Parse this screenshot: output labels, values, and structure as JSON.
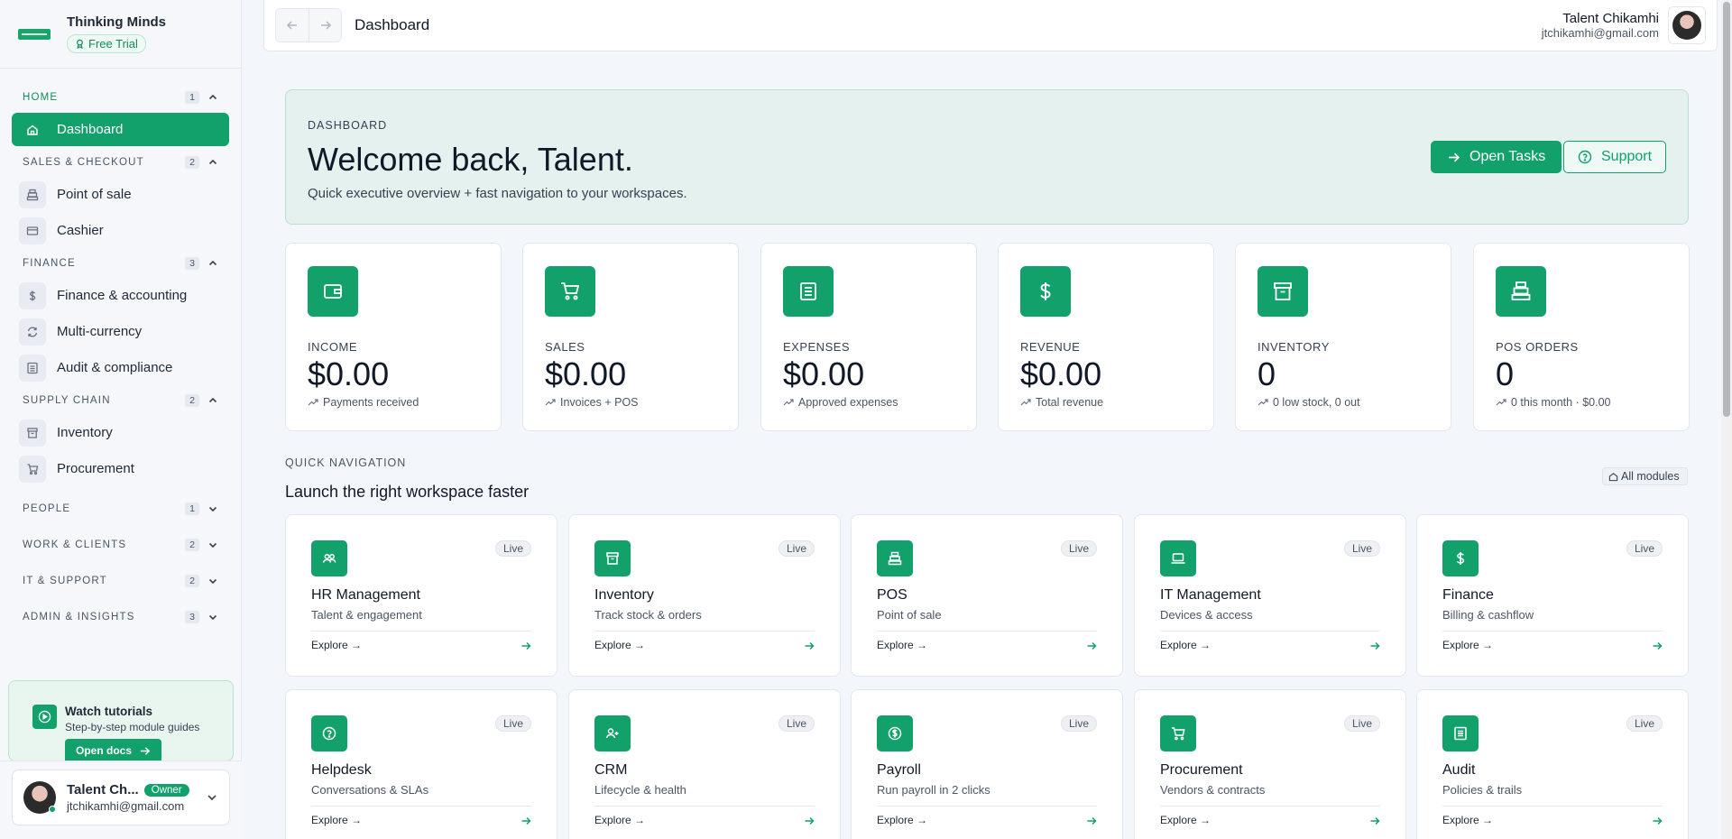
{
  "brand": {
    "name": "Thinking Minds",
    "trial_label": "Free Trial"
  },
  "sidebar": {
    "groups": [
      {
        "title": "HOME",
        "count": "1",
        "items": [
          {
            "label": "Dashboard"
          }
        ]
      },
      {
        "title": "SALES & CHECKOUT",
        "count": "2",
        "items": [
          {
            "label": "Point of sale"
          },
          {
            "label": "Cashier"
          }
        ]
      },
      {
        "title": "FINANCE",
        "count": "3",
        "items": [
          {
            "label": "Finance & accounting"
          },
          {
            "label": "Multi-currency"
          },
          {
            "label": "Audit & compliance"
          }
        ]
      },
      {
        "title": "SUPPLY CHAIN",
        "count": "2",
        "items": [
          {
            "label": "Inventory"
          },
          {
            "label": "Procurement"
          }
        ]
      },
      {
        "title": "PEOPLE",
        "count": "1"
      },
      {
        "title": "WORK & CLIENTS",
        "count": "2"
      },
      {
        "title": "IT & SUPPORT",
        "count": "2"
      },
      {
        "title": "ADMIN & INSIGHTS",
        "count": "3"
      }
    ],
    "tutorial": {
      "title": "Watch tutorials",
      "subtitle": "Step-by-step module guides",
      "button": "Open docs"
    },
    "user": {
      "name": "Talent Ch...",
      "role": "Owner",
      "email": "jtchikamhi@gmail.com"
    }
  },
  "topbar": {
    "title": "Dashboard",
    "user_name": "Talent Chikamhi",
    "user_email": "jtchikamhi@gmail.com"
  },
  "hero": {
    "eyebrow": "DASHBOARD",
    "title": "Welcome back, Talent.",
    "subtitle": "Quick executive overview + fast navigation to your workspaces.",
    "primary_button": "Open Tasks",
    "secondary_button": "Support"
  },
  "stats": [
    {
      "label": "INCOME",
      "value": "$0.00",
      "note": "Payments received",
      "icon": "wallet-icon"
    },
    {
      "label": "SALES",
      "value": "$0.00",
      "note": "Invoices + POS",
      "icon": "cart-icon"
    },
    {
      "label": "EXPENSES",
      "value": "$0.00",
      "note": "Approved expenses",
      "icon": "receipt-icon"
    },
    {
      "label": "REVENUE",
      "value": "$0.00",
      "note": "Total revenue",
      "icon": "dollar-icon"
    },
    {
      "label": "INVENTORY",
      "value": "0",
      "note": "0 low stock, 0 out",
      "icon": "archive-icon"
    },
    {
      "label": "POS ORDERS",
      "value": "0",
      "note": "0 this month · $0.00",
      "icon": "register-icon"
    }
  ],
  "quick_nav": {
    "eyebrow": "QUICK NAVIGATION",
    "title": "Launch the right workspace faster",
    "all_modules": "All modules",
    "modules": [
      {
        "title": "HR Management",
        "subtitle": "Talent & engagement",
        "status": "Live",
        "explore": "Explore →",
        "icon": "users-icon"
      },
      {
        "title": "Inventory",
        "subtitle": "Track stock & orders",
        "status": "Live",
        "explore": "Explore →",
        "icon": "archive-icon"
      },
      {
        "title": "POS",
        "subtitle": "Point of sale",
        "status": "Live",
        "explore": "Explore →",
        "icon": "register-icon"
      },
      {
        "title": "IT Management",
        "subtitle": "Devices & access",
        "status": "Live",
        "explore": "Explore →",
        "icon": "laptop-icon"
      },
      {
        "title": "Finance",
        "subtitle": "Billing & cashflow",
        "status": "Live",
        "explore": "Explore →",
        "icon": "dollar-icon"
      },
      {
        "title": "Helpdesk",
        "subtitle": "Conversations & SLAs",
        "status": "Live",
        "explore": "Explore →",
        "icon": "help-icon"
      },
      {
        "title": "CRM",
        "subtitle": "Lifecycle & health",
        "status": "Live",
        "explore": "Explore →",
        "icon": "user-plus-icon"
      },
      {
        "title": "Payroll",
        "subtitle": "Run payroll in 2 clicks",
        "status": "Live",
        "explore": "Explore →",
        "icon": "coin-icon"
      },
      {
        "title": "Procurement",
        "subtitle": "Vendors & contracts",
        "status": "Live",
        "explore": "Explore →",
        "icon": "cart-icon"
      },
      {
        "title": "Audit",
        "subtitle": "Policies & trails",
        "status": "Live",
        "explore": "Explore →",
        "icon": "ledger-icon"
      }
    ]
  },
  "colors": {
    "accent": "#12a06b",
    "hero_bg": "#e4f1ef",
    "sidebar_bg": "#f5f7fb"
  }
}
